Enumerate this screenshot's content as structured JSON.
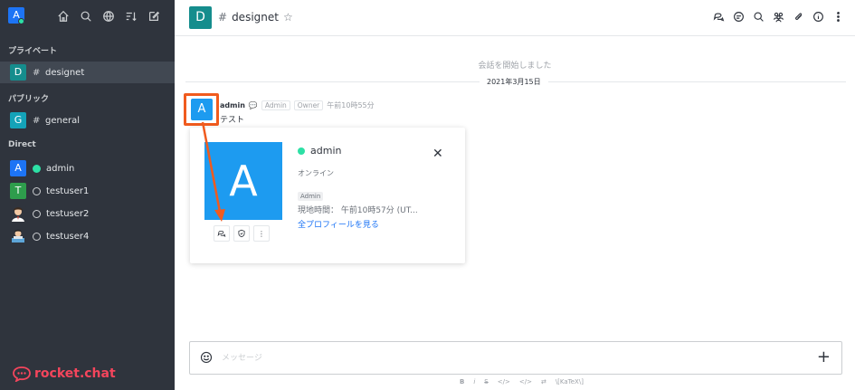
{
  "sidebar": {
    "user_avatar_letter": "A",
    "top_icons": [
      "home-icon",
      "search-icon",
      "directory-icon",
      "sort-icon",
      "create-new-icon"
    ],
    "sections": {
      "private": "プライベート",
      "public": "パブリック",
      "direct": "Direct"
    },
    "private_rooms": [
      {
        "letter": "D",
        "name": "designet",
        "color": "#158d8d"
      }
    ],
    "public_rooms": [
      {
        "letter": "G",
        "name": "general",
        "color": "#14a3b8"
      }
    ],
    "direct_users": [
      {
        "letter": "A",
        "name": "admin",
        "color": "#1d74f5",
        "status": "online"
      },
      {
        "letter": "T",
        "name": "testuser1",
        "color": "#2e9d4c",
        "status": "offline"
      },
      {
        "letter": "",
        "name": "testuser2",
        "status": "offline"
      },
      {
        "letter": "",
        "name": "testuser4",
        "status": "offline"
      }
    ],
    "logo_text": "rocket.chat"
  },
  "header": {
    "room_avatar_letter": "D",
    "room_name": "designet",
    "icons": [
      "threads-icon",
      "discussion-icon",
      "search-icon",
      "members-icon",
      "attachment-icon",
      "info-icon",
      "kebab-icon"
    ]
  },
  "messages": {
    "start_text": "会話を開始しました",
    "date_label": "2021年3月15日",
    "first": {
      "avatar_letter": "A",
      "username": "admin",
      "badge1": "Admin",
      "badge2": "Owner",
      "time": "午前10時55分",
      "text": "テスト"
    }
  },
  "profile_card": {
    "avatar_letter": "A",
    "name": "admin",
    "status": "オンライン",
    "role": "Admin",
    "local_time": "現地時間： 午前10時57分 (UT...",
    "view_profile": "全プロフィールを見る",
    "close": "✕",
    "more": "⋮"
  },
  "composer": {
    "placeholder": "メッセージ",
    "plus": "+"
  },
  "format_bar": [
    "B",
    "i",
    "S",
    "</>",
    "</>",
    "⇄",
    "\\[KaTeX\\]"
  ],
  "colors": {
    "sidebar_bg": "#2f343d",
    "accent_blue": "#1d74f5",
    "highlight_orange": "#f05b1e",
    "online_green": "#2de0a5",
    "logo_red": "#f5455c"
  }
}
